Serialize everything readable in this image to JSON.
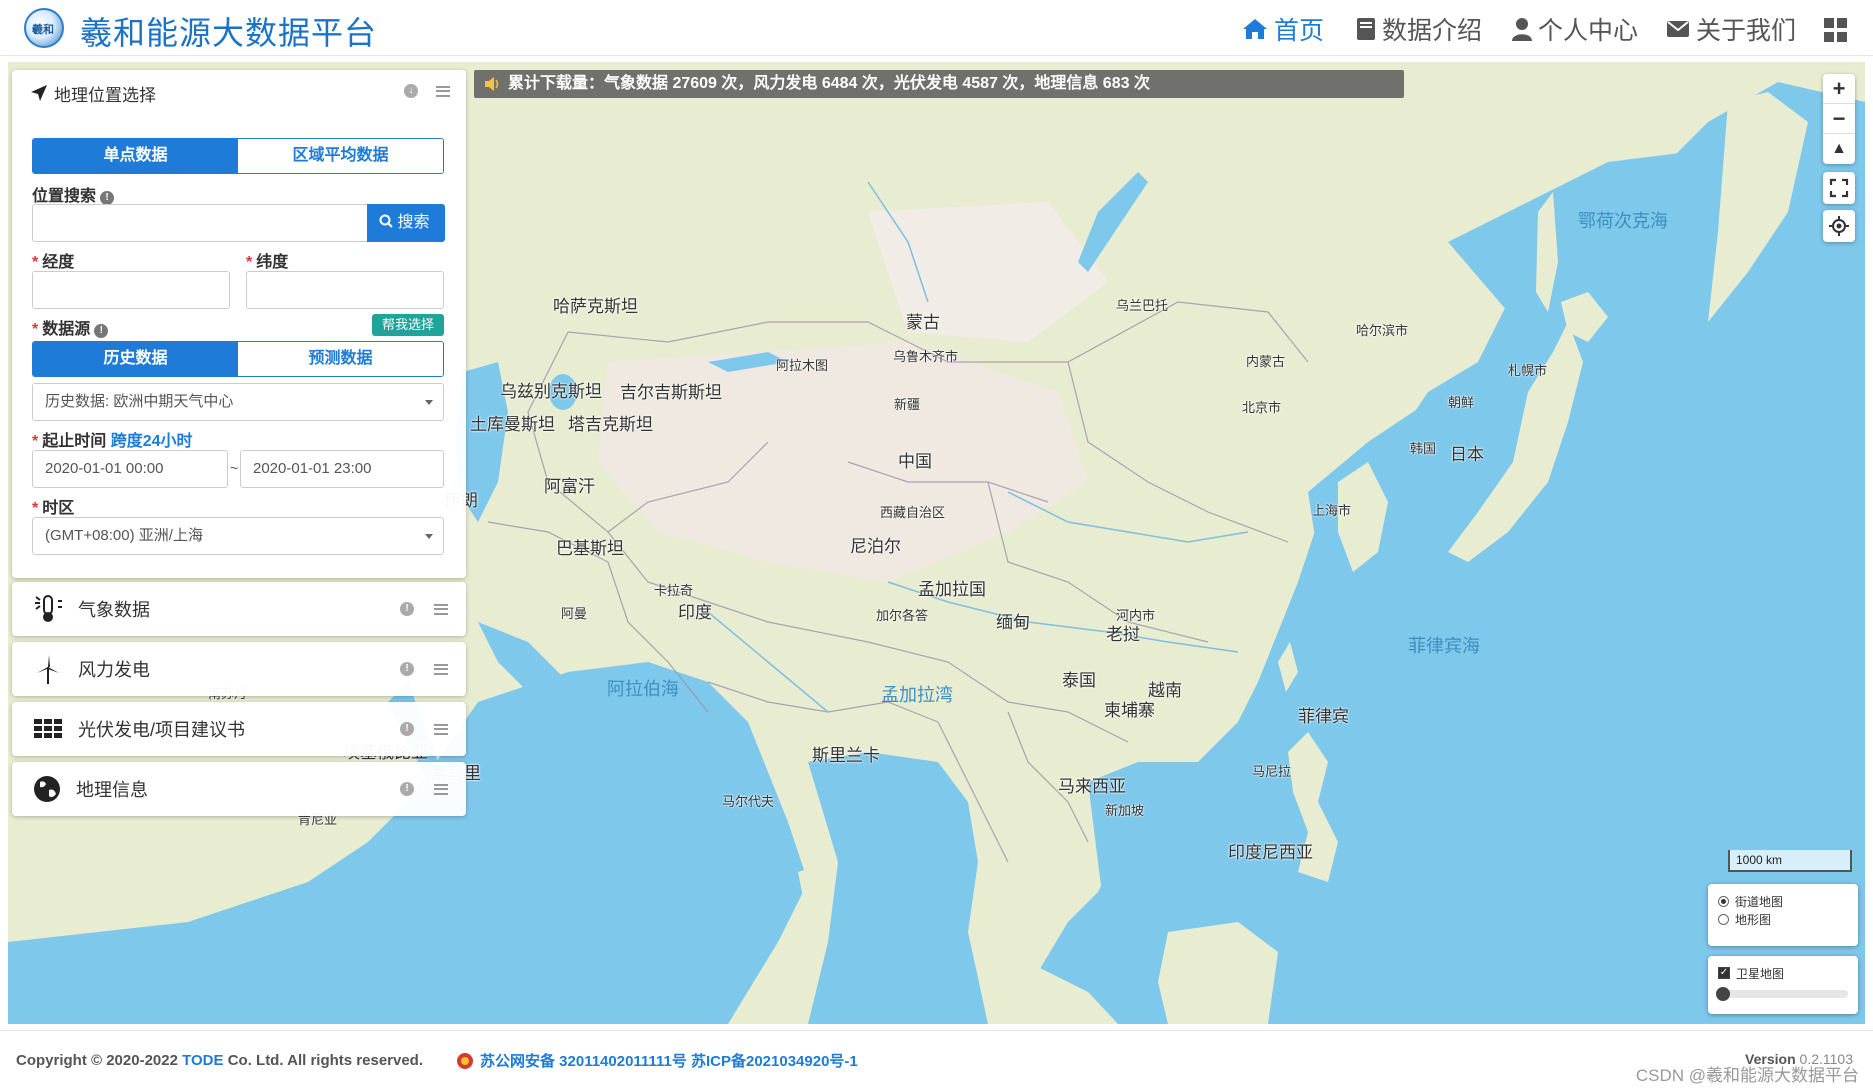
{
  "header": {
    "brand": "羲和能源大数据平台",
    "logo_text": "羲和",
    "nav": [
      {
        "label": "首页",
        "icon": "home-icon",
        "active": true
      },
      {
        "label": "数据介绍",
        "icon": "book-icon",
        "active": false
      },
      {
        "label": "个人中心",
        "icon": "user-icon",
        "active": false
      },
      {
        "label": "关于我们",
        "icon": "envelope-icon",
        "active": false
      }
    ],
    "apps_icon": "grid-icon"
  },
  "map": {
    "announcement": "累计下载量：气象数据 27609 次，风力发电 6484 次，光伏发电 4587 次，地理信息 683 次",
    "zoom_in": "+",
    "zoom_out": "−",
    "reset_north": "▲",
    "scale_label": "1000 km",
    "basemap_options": [
      {
        "label": "街道地图",
        "selected": true
      },
      {
        "label": "地形图",
        "selected": false
      }
    ],
    "satellite": {
      "label": "卫星地图",
      "checked": true,
      "opacity": 0
    },
    "labels": [
      {
        "text": "中国",
        "cls": "big"
      },
      {
        "text": "蒙古",
        "cls": "big"
      },
      {
        "text": "印度",
        "cls": "big"
      },
      {
        "text": "日本",
        "cls": "big"
      },
      {
        "text": "哈萨克斯坦",
        "cls": "big"
      },
      {
        "text": "乌兹别克斯坦",
        "cls": "big"
      },
      {
        "text": "吉尔吉斯斯坦",
        "cls": "big"
      },
      {
        "text": "塔吉克斯坦",
        "cls": "big"
      },
      {
        "text": "土库曼斯坦",
        "cls": "big"
      },
      {
        "text": "阿富汗",
        "cls": "big"
      },
      {
        "text": "巴基斯坦",
        "cls": "big"
      },
      {
        "text": "伊朗",
        "cls": "big"
      },
      {
        "text": "尼泊尔",
        "cls": "big"
      },
      {
        "text": "孟加拉国",
        "cls": "big"
      },
      {
        "text": "缅甸",
        "cls": "big"
      },
      {
        "text": "泰国",
        "cls": "big"
      },
      {
        "text": "老挝",
        "cls": "big"
      },
      {
        "text": "越南",
        "cls": "big"
      },
      {
        "text": "柬埔寨",
        "cls": "big"
      },
      {
        "text": "菲律宾",
        "cls": "big"
      },
      {
        "text": "马来西亚",
        "cls": "big"
      },
      {
        "text": "印度尼西亚",
        "cls": "big"
      },
      {
        "text": "韩国",
        "cls": ""
      },
      {
        "text": "朝鲜",
        "cls": ""
      },
      {
        "text": "斯里兰卡",
        "cls": "big"
      },
      {
        "text": "马尔代夫",
        "cls": ""
      },
      {
        "text": "阿曼",
        "cls": ""
      },
      {
        "text": "索马里",
        "cls": "big"
      },
      {
        "text": "埃塞俄比亚",
        "cls": "big"
      },
      {
        "text": "肯尼亚",
        "cls": ""
      },
      {
        "text": "南苏丹",
        "cls": ""
      },
      {
        "text": "乌鲁木齐市",
        "cls": ""
      },
      {
        "text": "北京市",
        "cls": ""
      },
      {
        "text": "上海市",
        "cls": ""
      },
      {
        "text": "哈尔滨市",
        "cls": ""
      },
      {
        "text": "阿拉木图",
        "cls": ""
      },
      {
        "text": "乌兰巴托",
        "cls": ""
      },
      {
        "text": "河内市",
        "cls": ""
      },
      {
        "text": "加尔各答",
        "cls": ""
      },
      {
        "text": "卡拉奇",
        "cls": ""
      },
      {
        "text": "新加坡",
        "cls": ""
      },
      {
        "text": "马尼拉",
        "cls": ""
      },
      {
        "text": "札幌市",
        "cls": ""
      },
      {
        "text": "西藏自治区",
        "cls": ""
      },
      {
        "text": "新疆",
        "cls": ""
      },
      {
        "text": "内蒙古",
        "cls": ""
      },
      {
        "text": "阿拉伯海",
        "cls": "sea"
      },
      {
        "text": "孟加拉湾",
        "cls": "sea"
      },
      {
        "text": "菲律宾海",
        "cls": "sea"
      },
      {
        "text": "鄂荷次克海",
        "cls": "sea"
      }
    ]
  },
  "panel": {
    "title": "地理位置选择",
    "mode_tabs": [
      {
        "label": "单点数据",
        "active": true
      },
      {
        "label": "区域平均数据",
        "active": false
      }
    ],
    "search": {
      "label": "位置搜索",
      "value": "",
      "placeholder": "",
      "button": "搜索"
    },
    "longitude": {
      "label": "经度",
      "value": ""
    },
    "latitude": {
      "label": "纬度",
      "value": ""
    },
    "source": {
      "label": "数据源",
      "help_button": "帮我选择",
      "tabs": [
        {
          "label": "历史数据",
          "active": true
        },
        {
          "label": "预测数据",
          "active": false
        }
      ],
      "selected": "历史数据: 欧洲中期天气中心"
    },
    "time": {
      "label": "起止时间",
      "span_hint": "跨度24小时",
      "start": "2020-01-01 00:00",
      "separator": "~",
      "end": "2020-01-01 23:00"
    },
    "timezone": {
      "label": "时区",
      "selected": "(GMT+08:00) 亚洲/上海"
    }
  },
  "accordions": [
    {
      "label": "气象数据",
      "icon": "thermometer-sun-icon"
    },
    {
      "label": "风力发电",
      "icon": "wind-turbine-icon"
    },
    {
      "label": "光伏发电/项目建议书",
      "icon": "solar-panel-icon"
    },
    {
      "label": "地理信息",
      "icon": "globe-icon"
    }
  ],
  "footer": {
    "copyright_prefix": "Copyright © 2020-2022 ",
    "company": "TODE",
    "copyright_suffix": " Co. Ltd. All rights reserved.",
    "beian": "苏公网安备 32011402011111号 苏ICP备2021034920号-1",
    "version_label": "Version",
    "version_number": "0.2.1103",
    "watermark": "CSDN @羲和能源大数据平台"
  },
  "colors": {
    "primary": "#1f7bd8",
    "teal": "#1fa39a",
    "required": "#d9363e",
    "sea": "#7ec8ec",
    "land": "#e8edd2"
  }
}
